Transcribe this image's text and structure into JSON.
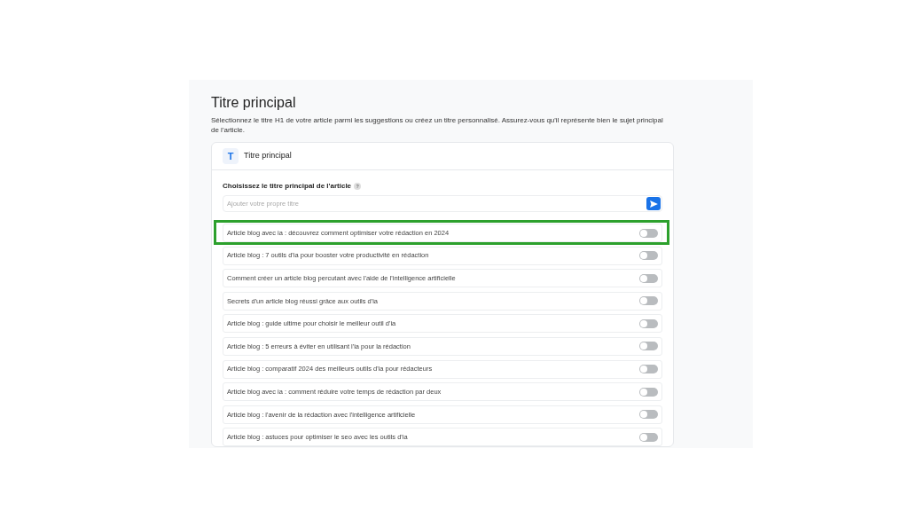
{
  "page": {
    "title": "Titre principal",
    "description": "Sélectionnez le titre H1 de votre article parmi les suggestions ou créez un titre personnalisé. Assurez-vous qu'il représente bien le sujet principal de l'article."
  },
  "card": {
    "icon_letter": "T",
    "title": "Titre principal",
    "field_label": "Choisissez le titre principal de l'article",
    "help_mark": "?",
    "input": {
      "placeholder": "Ajouter votre propre titre"
    }
  },
  "suggestions": [
    {
      "text": "Article blog avec ia : découvrez comment optimiser votre rédaction en 2024",
      "on": false,
      "highlighted": true
    },
    {
      "text": "Article blog : 7 outils d'ia pour booster votre productivité en rédaction",
      "on": false,
      "highlighted": false
    },
    {
      "text": "Comment créer un article blog percutant avec l'aide de l'intelligence artificielle",
      "on": false,
      "highlighted": false
    },
    {
      "text": "Secrets d'un article blog réussi grâce aux outils d'ia",
      "on": false,
      "highlighted": false
    },
    {
      "text": "Article blog : guide ultime pour choisir le meilleur outil d'ia",
      "on": false,
      "highlighted": false
    },
    {
      "text": "Article blog : 5 erreurs à éviter en utilisant l'ia pour la rédaction",
      "on": false,
      "highlighted": false
    },
    {
      "text": "Article blog : comparatif 2024 des meilleurs outils d'ia pour rédacteurs",
      "on": false,
      "highlighted": false
    },
    {
      "text": "Article blog avec ia : comment réduire votre temps de rédaction par deux",
      "on": false,
      "highlighted": false
    },
    {
      "text": "Article blog : l'avenir de la rédaction avec l'intelligence artificielle",
      "on": false,
      "highlighted": false
    },
    {
      "text": "Article blog : astuces pour optimiser le seo avec les outils d'ia",
      "on": false,
      "highlighted": false
    }
  ]
}
